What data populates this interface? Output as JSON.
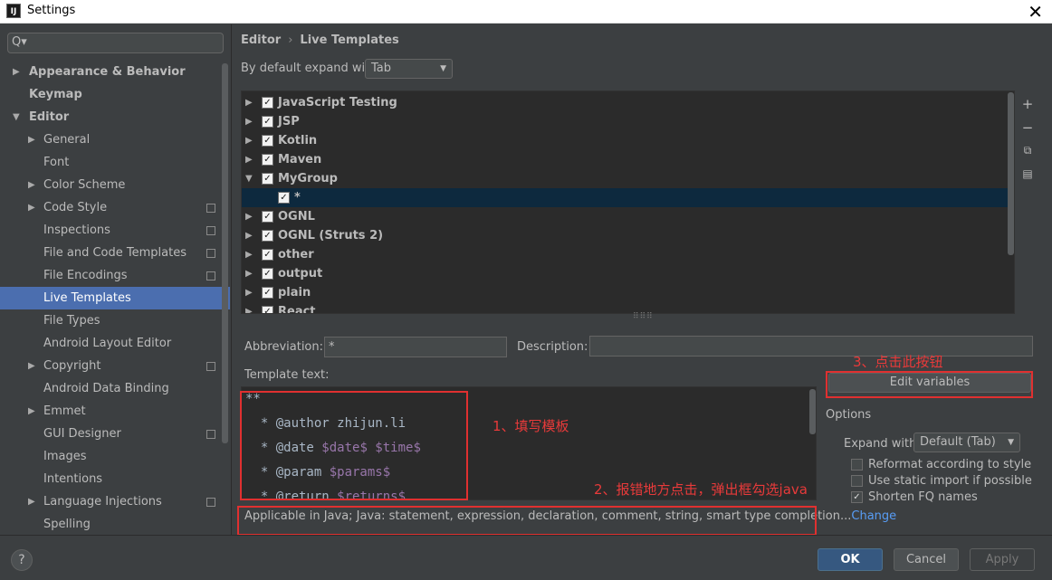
{
  "window": {
    "title": "Settings",
    "app_icon": "IJ"
  },
  "sidebar": {
    "search_placeholder": "",
    "search_glyph": "Q▾",
    "items": [
      {
        "label": "Appearance & Behavior",
        "bold": true,
        "arrow": "▶"
      },
      {
        "label": "Keymap",
        "bold": true,
        "arrow": ""
      },
      {
        "label": "Editor",
        "bold": true,
        "arrow": "▼"
      },
      {
        "label": "General",
        "arrow": "▶"
      },
      {
        "label": "Font",
        "arrow": ""
      },
      {
        "label": "Color Scheme",
        "arrow": "▶"
      },
      {
        "label": "Code Style",
        "arrow": "▶",
        "copy": true
      },
      {
        "label": "Inspections",
        "arrow": "",
        "copy": true
      },
      {
        "label": "File and Code Templates",
        "arrow": "",
        "copy": true
      },
      {
        "label": "File Encodings",
        "arrow": "",
        "copy": true
      },
      {
        "label": "Live Templates",
        "arrow": "",
        "selected": true
      },
      {
        "label": "File Types",
        "arrow": ""
      },
      {
        "label": "Android Layout Editor",
        "arrow": ""
      },
      {
        "label": "Copyright",
        "arrow": "▶",
        "copy": true
      },
      {
        "label": "Android Data Binding",
        "arrow": ""
      },
      {
        "label": "Emmet",
        "arrow": "▶"
      },
      {
        "label": "GUI Designer",
        "arrow": "",
        "copy": true
      },
      {
        "label": "Images",
        "arrow": ""
      },
      {
        "label": "Intentions",
        "arrow": ""
      },
      {
        "label": "Language Injections",
        "arrow": "▶",
        "copy": true
      },
      {
        "label": "Spelling",
        "arrow": ""
      }
    ]
  },
  "breadcrumb": {
    "section": "Editor",
    "separator": "›",
    "page": "Live Templates"
  },
  "expand": {
    "label": "By default expand with",
    "value": "Tab"
  },
  "templates": {
    "rows": [
      {
        "name": "JavaScript Testing",
        "arrow": "▶",
        "checked": "✓"
      },
      {
        "name": "JSP",
        "arrow": "▶",
        "checked": "✓"
      },
      {
        "name": "Kotlin",
        "arrow": "▶",
        "checked": "✓"
      },
      {
        "name": "Maven",
        "arrow": "▶",
        "checked": "✓"
      },
      {
        "name": "MyGroup",
        "arrow": "▼",
        "checked": "✓"
      },
      {
        "name": "*",
        "arrow": "",
        "checked": "✓",
        "child": true,
        "selected": true
      },
      {
        "name": "OGNL",
        "arrow": "▶",
        "checked": "✓"
      },
      {
        "name": "OGNL (Struts 2)",
        "arrow": "▶",
        "checked": "✓"
      },
      {
        "name": "other",
        "arrow": "▶",
        "checked": "✓"
      },
      {
        "name": "output",
        "arrow": "▶",
        "checked": "✓"
      },
      {
        "name": "plain",
        "arrow": "▶",
        "checked": "✓"
      },
      {
        "name": "React",
        "arrow": "▶",
        "checked": "✓"
      }
    ],
    "toolbar": {
      "add": "+",
      "remove": "−",
      "copy": "⧉",
      "list": "▤"
    },
    "grip": "⠿⠿⠿"
  },
  "abbreviation": {
    "label": "Abbreviation:",
    "value": "*"
  },
  "description": {
    "label": "Description:",
    "value": ""
  },
  "template_text": {
    "label": "Template text:",
    "lines": [
      {
        "pre": "**",
        "var": "",
        "post": ""
      },
      {
        "pre": "  * @author zhijun.li",
        "var": "",
        "post": ""
      },
      {
        "pre": "  * @date ",
        "var": "$date$ $time$",
        "post": ""
      },
      {
        "pre": "  * @param ",
        "var": "$params$",
        "post": ""
      },
      {
        "pre": "  * @return ",
        "var": "$returns$",
        "post": ""
      }
    ]
  },
  "edit_variables": {
    "label": "Edit variables"
  },
  "options": {
    "title": "Options",
    "expand_with_label": "Expand with",
    "expand_with_value": "Default (Tab)",
    "checks": [
      {
        "label": "Reformat according to style",
        "checked": ""
      },
      {
        "label": "Use static import if possible",
        "checked": ""
      },
      {
        "label": "Shorten FQ names",
        "checked": "✓"
      }
    ]
  },
  "applicable": {
    "text": "Applicable in Java; Java: statement, expression, declaration, comment, string, smart type completion...",
    "link": "Change"
  },
  "annotations": {
    "a1": "1、填写模板",
    "a2": "2、报错地方点击，弹出框勾选java",
    "a3": "3、点击此按钮"
  },
  "footer": {
    "help": "?",
    "ok": "OK",
    "cancel": "Cancel",
    "apply": "Apply"
  },
  "colors": {
    "accent": "#4b6eaf",
    "annotation_red": "#e03030",
    "link": "#589df6",
    "background": "#3c3f41"
  }
}
